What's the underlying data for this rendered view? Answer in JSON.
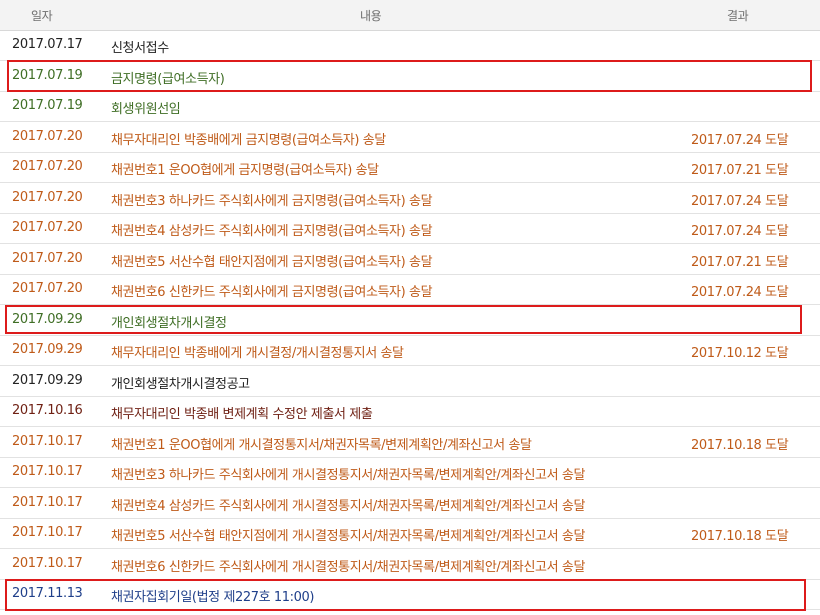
{
  "header": {
    "date": "일자",
    "content": "내용",
    "result": "결과"
  },
  "colors": {
    "black": "#222222",
    "green": "#3f6e25",
    "orange": "#bf5a18",
    "brown": "#6e1f12",
    "blue": "#1f3f8a",
    "highlight": "#dd1b1b"
  },
  "rows": [
    {
      "date": "2017.07.17",
      "content": "신청서접수",
      "result": "",
      "color": "black"
    },
    {
      "date": "2017.07.19",
      "content": "금지명령(급여소득자)",
      "result": "",
      "color": "green"
    },
    {
      "date": "2017.07.19",
      "content": "회생위원선임",
      "result": "",
      "color": "green"
    },
    {
      "date": "2017.07.20",
      "content": "채무자대리인 박종배에게 금지명령(급여소득자) 송달",
      "result": "2017.07.24 도달",
      "color": "orange"
    },
    {
      "date": "2017.07.20",
      "content": "채권번호1 운OO협에게 금지명령(급여소득자) 송달",
      "result": "2017.07.21 도달",
      "color": "orange"
    },
    {
      "date": "2017.07.20",
      "content": "채권번호3 하나카드 주식회사에게 금지명령(급여소득자) 송달",
      "result": "2017.07.24 도달",
      "color": "orange"
    },
    {
      "date": "2017.07.20",
      "content": "채권번호4 삼성카드 주식회사에게 금지명령(급여소득자) 송달",
      "result": "2017.07.24 도달",
      "color": "orange"
    },
    {
      "date": "2017.07.20",
      "content": "채권번호5 서산수협 태안지점에게 금지명령(급여소득자) 송달",
      "result": "2017.07.21 도달",
      "color": "orange"
    },
    {
      "date": "2017.07.20",
      "content": "채권번호6 신한카드 주식회사에게 금지명령(급여소득자) 송달",
      "result": "2017.07.24 도달",
      "color": "orange"
    },
    {
      "date": "2017.09.29",
      "content": "개인회생절차개시결정",
      "result": "",
      "color": "green"
    },
    {
      "date": "2017.09.29",
      "content": "채무자대리인 박종배에게 개시결정/개시결정통지서 송달",
      "result": "2017.10.12 도달",
      "color": "orange"
    },
    {
      "date": "2017.09.29",
      "content": "개인회생절차개시결정공고",
      "result": "",
      "color": "black"
    },
    {
      "date": "2017.10.16",
      "content": "채무자대리인 박종배 변제계획 수정안 제출서 제출",
      "result": "",
      "color": "brown"
    },
    {
      "date": "2017.10.17",
      "content": "채권번호1 운OO협에게 개시결정통지서/채권자목록/변제계획안/계좌신고서 송달",
      "result": "2017.10.18 도달",
      "color": "orange"
    },
    {
      "date": "2017.10.17",
      "content": "채권번호3 하나카드 주식회사에게 개시결정통지서/채권자목록/변제계획안/계좌신고서 송달",
      "result": "",
      "color": "orange"
    },
    {
      "date": "2017.10.17",
      "content": "채권번호4 삼성카드 주식회사에게 개시결정통지서/채권자목록/변제계획안/계좌신고서 송달",
      "result": "",
      "color": "orange"
    },
    {
      "date": "2017.10.17",
      "content": "채권번호5 서산수협 태안지점에게 개시결정통지서/채권자목록/변제계획안/계좌신고서 송달",
      "result": "2017.10.18 도달",
      "color": "orange"
    },
    {
      "date": "2017.10.17",
      "content": "채권번호6 신한카드 주식회사에게 개시결정통지서/채권자목록/변제계획안/계좌신고서 송달",
      "result": "",
      "color": "orange"
    },
    {
      "date": "2017.11.13",
      "content": "채권자집회기일(법정 제227호 11:00)",
      "result": "",
      "color": "blue"
    }
  ]
}
